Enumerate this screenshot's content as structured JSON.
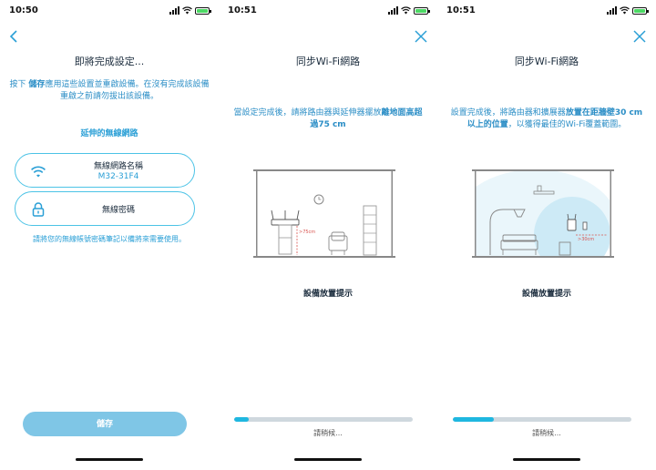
{
  "screens": [
    {
      "status": {
        "time": "10:50"
      },
      "title": "即將完成設定...",
      "description": {
        "before": "按下 ",
        "bold": "儲存",
        "after": "應用這些設置並重啟設備。在沒有完成該設備重啟之前請勿拔出該設備。"
      },
      "section_label": "延伸的無線網路",
      "network_name": {
        "label": "無線網路名稱",
        "value": "M32-31F4"
      },
      "password": {
        "label": "無線密碼"
      },
      "note": "請將您的無線帳號密碼筆記以備將來需要使用。",
      "save_label": "儲存",
      "nav_icon": "chevron-left-icon",
      "colors": {
        "accent": "#2a9fd6",
        "pill_border": "#4cc3e6",
        "button": "#7fc6e6"
      }
    },
    {
      "status": {
        "time": "10:51"
      },
      "title": "同步Wi-Fi網路",
      "description": {
        "before": "當設定完成後，請將路由器與延伸器擺放",
        "bold": "離地面高超過75 cm",
        "after": ""
      },
      "measure_label": ">75cm",
      "tip": "設備放置提示",
      "progress": 0.08,
      "wait": "請稍候...",
      "nav_icon": "close-icon",
      "colors": {
        "progress": "#1fb7e0",
        "track": "#cfd8de"
      }
    },
    {
      "status": {
        "time": "10:51"
      },
      "title": "同步Wi-Fi網路",
      "description": {
        "before": "設置完成後，將路由器和擴展器",
        "bold": "放置在距牆壁30 cm以上的位置",
        "after": "，以獲得最佳的Wi-Fi覆蓋範圍。"
      },
      "measure_label": ">30cm",
      "tip": "設備放置提示",
      "progress": 0.23,
      "wait": "請稍候...",
      "nav_icon": "close-icon",
      "colors": {
        "coverage": "#d6eef7"
      }
    }
  ]
}
